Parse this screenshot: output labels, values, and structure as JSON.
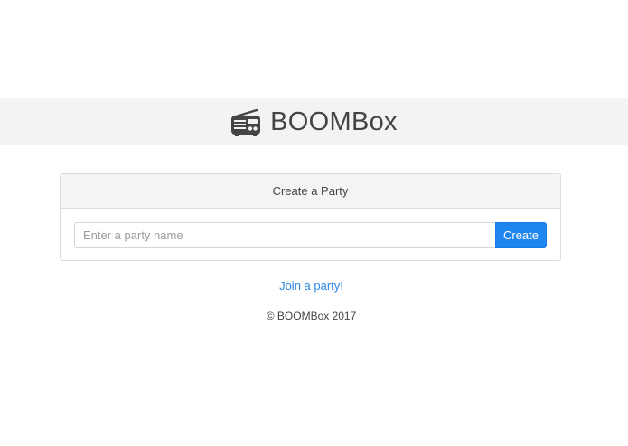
{
  "brand": {
    "name": "BOOMBox",
    "icon": "radio-icon"
  },
  "create_card": {
    "header": "Create a Party",
    "input_value": "",
    "input_placeholder": "Enter a party name",
    "button_label": "Create"
  },
  "join_link": "Join a party!",
  "footer": "© BOOMBox 2017",
  "colors": {
    "accent": "#1f86f0",
    "link": "#2a86e0",
    "brand_bar": "#f3f3f3"
  }
}
